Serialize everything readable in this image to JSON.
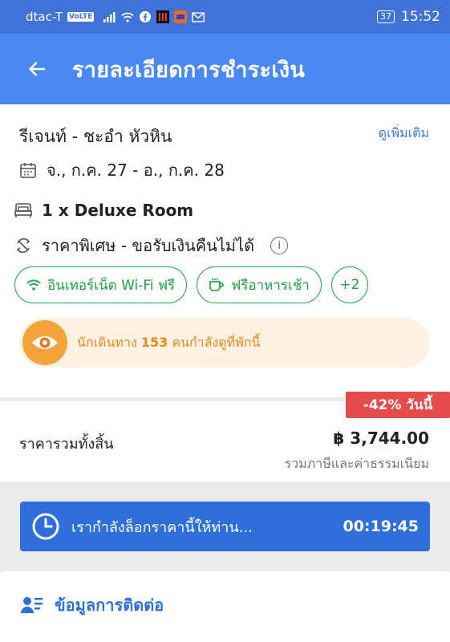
{
  "status": {
    "carrier": "dtac-T",
    "volte": "VoLTE",
    "battery": "37",
    "time": "15:52"
  },
  "header": {
    "title": "รายละเอียดการชำระเงิน"
  },
  "booking": {
    "hotel": "รีเจนท์ - ชะอำ หัวหิน",
    "more_link": "ดูเพิ่มเติม",
    "dates": "จ., ก.ค. 27 - อ., ก.ค. 28",
    "room": "1 x Deluxe Room",
    "rate": "ราคาพิเศษ - ขอรับเงินคืนไม่ได้",
    "amenities": [
      "อินเทอร์เน็ต Wi-Fi ฟรี",
      "ฟรีอาหารเช้า",
      "+2"
    ],
    "viewers_prefix": "นักเดินทาง ",
    "viewers_count": "153",
    "viewers_suffix": " คนกำลังดูที่พักนี้"
  },
  "price": {
    "deal_badge": "-42% วันนี้",
    "total_label": "ราคารวมทั้งสิ้น",
    "total_value": "฿ 3,744.00",
    "tax_note": "รวมภาษีและค่าธรรมเนียม"
  },
  "lock": {
    "text": "เรากำลังล็อกราคานี้ให้ท่าน...",
    "timer": "00:19:45"
  },
  "contact": {
    "label": "ข้อมูลการติดต่อ"
  },
  "colors": {
    "primary": "#4a89f3",
    "status_bar": "#3f73d9",
    "green": "#23a94a",
    "deal_red": "#e64b4b",
    "orange": "#f4a43a"
  }
}
